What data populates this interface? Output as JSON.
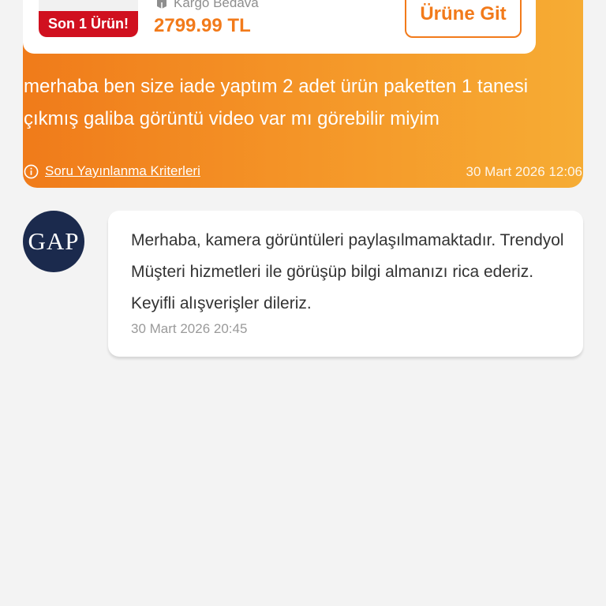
{
  "question": {
    "product": {
      "stock_badge": "Son 1 Ürün!",
      "shipping_label": "Kargo Bedava",
      "shipping_icon": "package-icon",
      "price": "2799.99 TL",
      "go_button_label": "Ürüne Git"
    },
    "text": "merhaba ben size iade yaptım 2 adet ürün paketten 1 tanesi çıkmış galiba görüntü video var mı görebilir miyim",
    "criteria_label": "Soru Yayınlanma Kriterleri",
    "criteria_icon": "info-icon",
    "date": "30 Mart 2026 12:06"
  },
  "answer": {
    "seller_logo_text": "GAP",
    "text": "Merhaba, kamera görüntüleri paylaşılmamaktadır. Trendyol Müşteri hizmetleri ile görüşüp bilgi almanızı rica ederiz. Keyifli alışverişler dileriz.",
    "date": "30 Mart 2026 20:45"
  },
  "colors": {
    "accent": "#f27a1a",
    "badge_red": "#d0101f",
    "avatar_navy": "#1b2a4d",
    "background": "#f3f3f3"
  }
}
